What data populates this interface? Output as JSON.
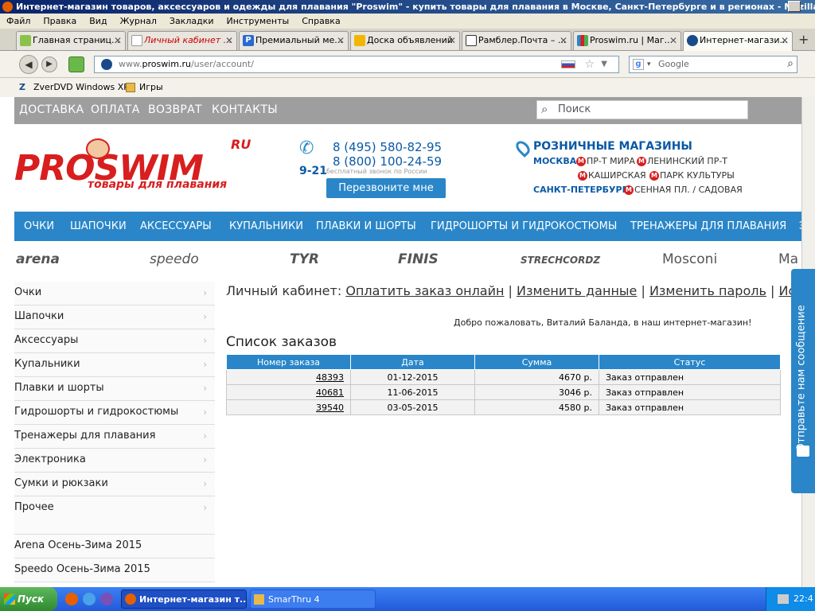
{
  "window": {
    "title": "Интернет-магазин товаров, аксессуаров и одежды для плавания \"Proswim\" - купить товары для плавания в Москве, Санкт-Петербурге и в регионах - Mozilla ..."
  },
  "menu": [
    "Файл",
    "Правка",
    "Вид",
    "Журнал",
    "Закладки",
    "Инструменты",
    "Справка"
  ],
  "tabs": [
    {
      "label": "Главная страниц..."
    },
    {
      "label": "Личный кабинет ..."
    },
    {
      "label": "Премиальный ме..."
    },
    {
      "label": "Доска объявлений"
    },
    {
      "label": "Рамблер.Почта – ..."
    },
    {
      "label": "Proswim.ru | Маг..."
    },
    {
      "label": "Интернет-магази..."
    }
  ],
  "url": {
    "prefix": "www.",
    "domain": "proswim.ru",
    "path": "/user/account/"
  },
  "search_engine": "Google",
  "bookmarks": [
    "ZverDVD Windows XP",
    "Игры"
  ],
  "site": {
    "top_links": [
      "ДОСТАВКА",
      "ОПЛАТА",
      "ВОЗВРАТ",
      "КОНТАКТЫ"
    ],
    "search_placeholder": "Поиск",
    "logo": "PROSWIM",
    "logo_ru": "RU",
    "tagline": "товары для плавания",
    "phone1": "8 (495) 580-82-95",
    "phone2": "8 (800) 100-24-59",
    "hours": "9-21",
    "free_call": "бесплатный звонок по России",
    "call_button": "Перезвоните мне",
    "stores_title": "РОЗНИЧНЫЕ МАГАЗИНЫ",
    "moscow": "МОСКВА",
    "moscow_stores": [
      "ПР-Т МИРА",
      "ЛЕНИНСКИЙ ПР-Т",
      "КАШИРСКАЯ",
      "ПАРК КУЛЬТУРЫ"
    ],
    "spb": "САНКТ-ПЕТЕРБУРГ",
    "spb_store": "СЕННАЯ ПЛ. / САДОВАЯ",
    "metro_letter": "М",
    "categories": [
      "ОЧКИ",
      "ШАПОЧКИ",
      "АКСЕССУАРЫ",
      "КУПАЛЬНИКИ",
      "ПЛАВКИ И ШОРТЫ",
      "ГИДРОШОРТЫ И ГИДРОКОСТЮМЫ",
      "ТРЕНАЖЕРЫ ДЛЯ ПЛАВАНИЯ",
      "ЭЛ"
    ],
    "brands": [
      "arena",
      "speedo",
      "TYR",
      "FINIS",
      "STRECHCORDZ",
      "Mosconi",
      "Ma"
    ],
    "sidebar": [
      "Очки",
      "Шапочки",
      "Аксессуары",
      "Купальники",
      "Плавки и шорты",
      "Гидрошорты и гидрокостюмы",
      "Тренажеры для плавания",
      "Электроника",
      "Сумки и рюкзаки",
      "Прочее"
    ],
    "sidebar_extra": [
      "Arena Осень-Зима 2015",
      "Speedo Осень-Зима 2015"
    ],
    "account_label": "Личный кабинет:",
    "account_links": [
      "Оплатить заказ онлайн",
      "Изменить данные",
      "Изменить пароль",
      "История за"
    ],
    "welcome": "Добро пожаловать, Виталий Баланда, в наш интернет-магазин!",
    "orders_title": "Список заказов",
    "orders_headers": [
      "Номер заказа",
      "Дата",
      "Сумма",
      "Статус"
    ],
    "orders": [
      {
        "num": "48393",
        "date": "01-12-2015",
        "sum": "4670 р.",
        "status": "Заказ отправлен"
      },
      {
        "num": "40681",
        "date": "11-06-2015",
        "sum": "3046 р.",
        "status": "Заказ отправлен"
      },
      {
        "num": "39540",
        "date": "03-05-2015",
        "sum": "4580 р.",
        "status": "Заказ отправлен"
      }
    ],
    "feedback": "Отправьте нам сообщение"
  },
  "taskbar": {
    "start": "Пуск",
    "items": [
      "Интернет-магазин т...",
      "SmarThru 4"
    ],
    "clock": "22:4"
  },
  "colors": {
    "accent": "#2a86c8",
    "brand_red": "#d81e1e",
    "topbar": "#9e9e9e"
  }
}
